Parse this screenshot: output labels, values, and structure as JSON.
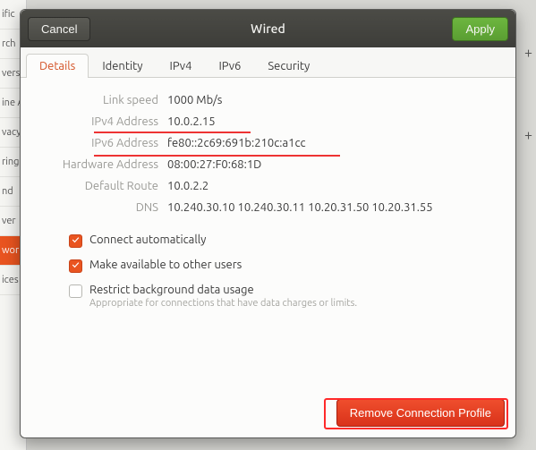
{
  "window": {
    "title": "Wired",
    "cancel": "Cancel",
    "apply": "Apply"
  },
  "tabs": {
    "details": "Details",
    "identity": "Identity",
    "ipv4": "IPv4",
    "ipv6": "IPv6",
    "security": "Security"
  },
  "details": {
    "link_speed_label": "Link speed",
    "link_speed_value": "1000 Mb/s",
    "ipv4_label": "IPv4 Address",
    "ipv4_value": "10.0.2.15",
    "ipv6_label": "IPv6 Address",
    "ipv6_value": "fe80::2c69:691b:210c:a1cc",
    "hw_label": "Hardware Address",
    "hw_value": "08:00:27:F0:68:1D",
    "route_label": "Default Route",
    "route_value": "10.0.2.2",
    "dns_label": "DNS",
    "dns_value": "10.240.30.10 10.240.30.11 10.20.31.50 10.20.31.55"
  },
  "checks": {
    "auto": "Connect automatically",
    "share": "Make available to other users",
    "restrict": "Restrict background data usage",
    "restrict_sub": "Appropriate for connections that have data charges or limits."
  },
  "footer": {
    "remove": "Remove Connection Profile"
  },
  "bg": {
    "i0": "ific",
    "i1": "rch",
    "i2": "vers",
    "i3": "ine A",
    "i4": "vacy",
    "i5": "ring",
    "i6": "nd",
    "i7": "ver",
    "i8": "wor",
    "i9": "ices"
  }
}
